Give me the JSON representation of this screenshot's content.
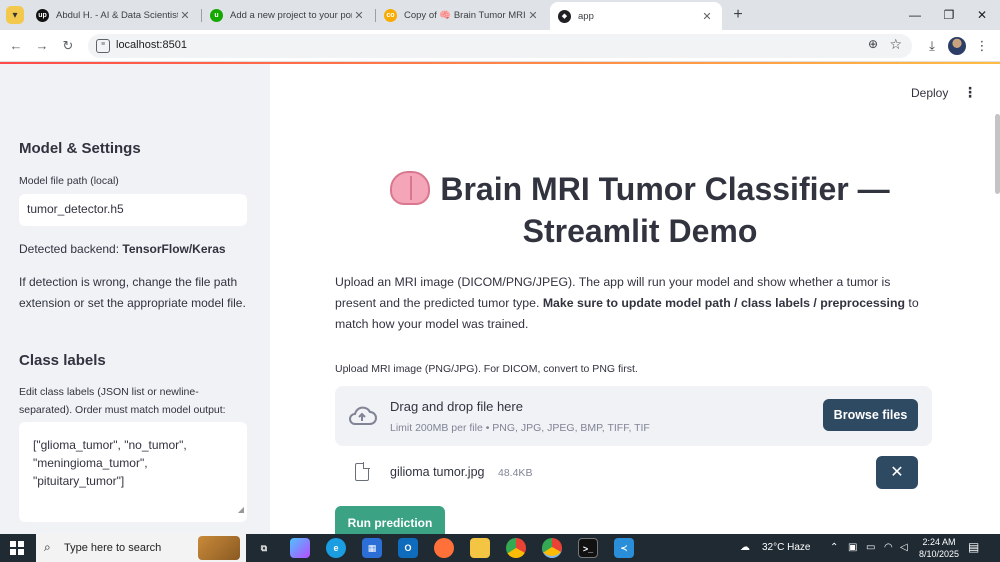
{
  "browser": {
    "tabs": [
      {
        "title": "Abdul H. - AI & Data Scientist |",
        "icon": "upwork-icon",
        "color": "#111111"
      },
      {
        "title": "Add a new project to your port",
        "icon": "upwork-icon",
        "color": "#14a800"
      },
      {
        "title": "Copy of 🧠 Brain Tumor MRI C",
        "icon": "colab-icon",
        "color": "#f9ab00"
      },
      {
        "title": "app",
        "icon": "streamlit-icon",
        "color": "#202124"
      }
    ],
    "url": "localhost:8501"
  },
  "sidebar": {
    "section1_title": "Model & Settings",
    "model_path_label": "Model file path (local)",
    "model_path_value": "tumor_detector.h5",
    "backend_prefix": "Detected backend: ",
    "backend_value": "TensorFlow/Keras",
    "hint": "If detection is wrong, change the file path extension or set the appropriate model file.",
    "section2_title": "Class labels",
    "labels_help": "Edit class labels (JSON list or newline-separated). Order must match model output:",
    "labels_value": "[\"glioma_tumor\", \"no_tumor\", \"meningioma_tumor\", \"pituitary_tumor\"]"
  },
  "main": {
    "deploy_label": "Deploy",
    "title": "Brain MRI Tumor Classifier — Streamlit Demo",
    "desc_plain": "Upload an MRI image (DICOM/PNG/JPEG). The app will run your model and show whether a tumor is present and the predicted tumor type. ",
    "desc_bold": "Make sure to update model path / class labels / preprocessing",
    "desc_tail": " to match how your model was trained.",
    "uploader_label": "Upload MRI image (PNG/JPG). For DICOM, convert to PNG first.",
    "drop_main": "Drag and drop file here",
    "drop_sub": "Limit 200MB per file • PNG, JPG, JPEG, BMP, TIFF, TIF",
    "browse_label": "Browse files",
    "file_name": "gilioma tumor.jpg",
    "file_size": "48.4KB",
    "run_label": "Run prediction",
    "accent_button": "#2e4a62",
    "accent_run": "#3ba283"
  },
  "taskbar": {
    "search_placeholder": "Type here to search",
    "weather": "32°C  Haze",
    "time": "2:24 AM",
    "date": "8/10/2025"
  }
}
